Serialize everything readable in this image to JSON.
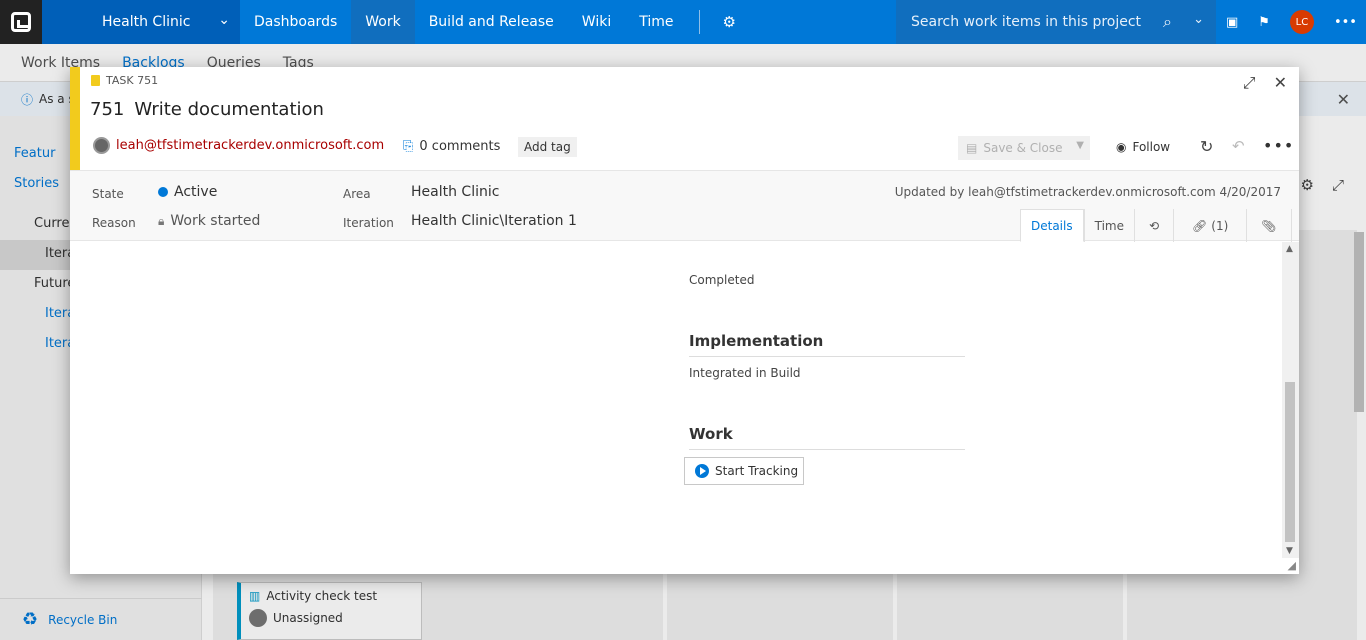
{
  "topbar": {
    "project": "Health Clinic",
    "nav": [
      "Dashboards",
      "Work",
      "Build and Release",
      "Wiki",
      "Time"
    ],
    "active_nav": "Work",
    "search_placeholder": "Search work items in this project",
    "avatar_initials": "LC"
  },
  "subnav": {
    "items": [
      "Work Items",
      "Backlogs",
      "Queries",
      "Tags"
    ]
  },
  "infobar": {
    "text": "As a s"
  },
  "sidebar": {
    "features": "Featur",
    "stories": "Stories",
    "current": "Curren",
    "iteration_current": "Itera",
    "future": "Future",
    "iteration_future_1": "Itera",
    "iteration_future_2": "Itera",
    "recycle_bin": "Recycle Bin"
  },
  "board_card": {
    "title": "Activity check test",
    "assignee": "Unassigned"
  },
  "dialog": {
    "type_label": "TASK 751",
    "id": "751",
    "title": "Write documentation",
    "assignee": "leah@tfstimetrackerdev.onmicrosoft.com",
    "comments": "0 comments",
    "add_tag": "Add tag",
    "save_close": "Save & Close",
    "follow": "Follow",
    "fields": {
      "state_label": "State",
      "state_value": "Active",
      "reason_label": "Reason",
      "reason_value": "Work started",
      "area_label": "Area",
      "area_value": "Health Clinic",
      "iteration_label": "Iteration",
      "iteration_value": "Health Clinic\\Iteration 1"
    },
    "updated": "Updated by leah@tfstimetrackerdev.onmicrosoft.com 4/20/2017",
    "tabs": [
      "Details",
      "Time",
      "(1)"
    ],
    "body": {
      "completed_text": "Completed",
      "implementation_head": "Implementation",
      "implementation_text": "Integrated in Build",
      "work_head": "Work",
      "start_tracking": "Start Tracking"
    }
  },
  "colors": {
    "brand_blue": "#0078d7",
    "task_yellow": "#f2cb1d",
    "assignee_red": "#a80000",
    "avatar_orange": "#d83b01"
  }
}
